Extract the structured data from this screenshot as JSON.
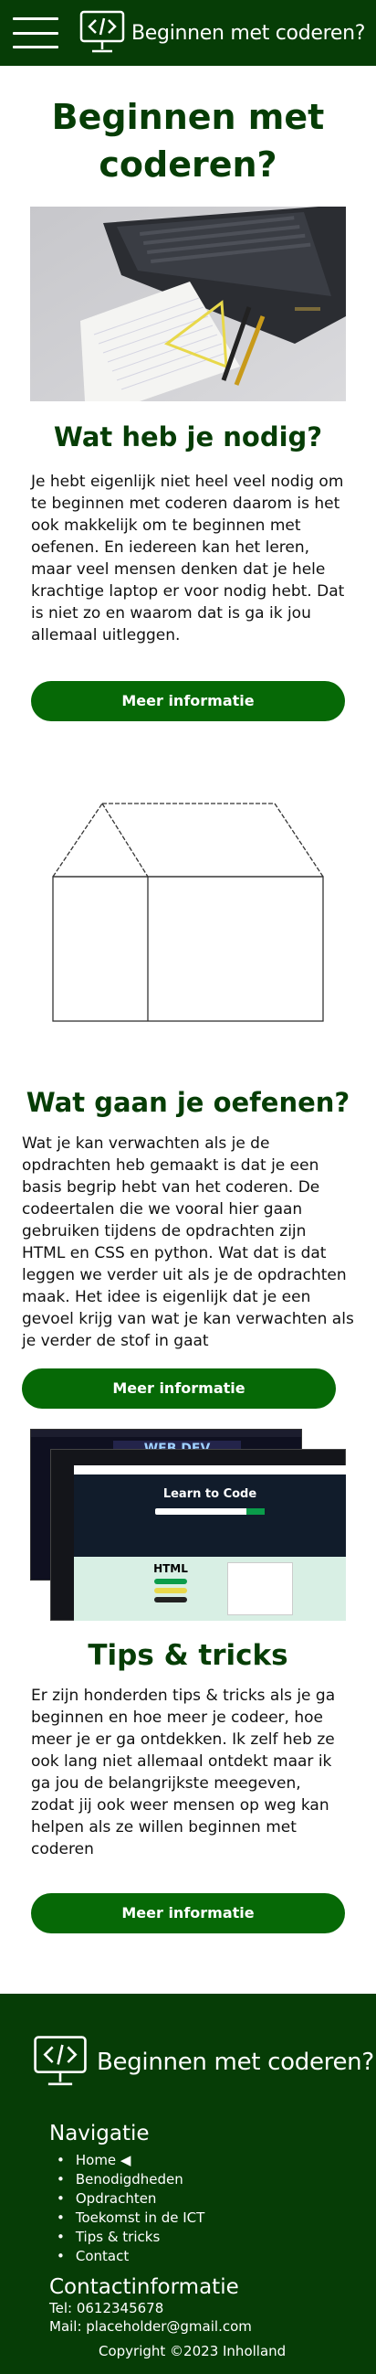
{
  "header": {
    "title": "Beginnen met coderen?",
    "brand_icon": "code-monitor-icon",
    "menu_icon": "hamburger-menu-icon",
    "background": "#063d06"
  },
  "hero": {
    "title": "Beginnen met coderen?",
    "image": "laptop-with-notebook-photo"
  },
  "sections": [
    {
      "title": "Wat heb je nodig?",
      "text": "Je hebt eigenlijk niet heel veel nodig om te beginnen met coderen daarom is het ook makkelijk om te beginnen met oefenen. En iedereen kan het leren, maar veel mensen denken dat je hele krachtige laptop er voor nodig hebt. Dat is niet zo en waarom dat is ga ik jou allemaal uitleggen.",
      "button": "Meer informatie",
      "image": "house-outline-drawing"
    },
    {
      "title": "Wat gaan je oefenen?",
      "text": "Wat je kan verwachten als je de opdrachten heb gemaakt is dat je een basis begrip hebt van het coderen. De codeertalen die we vooral hier gaan gebruiken tijdens de opdrachten zijn HTML en CSS en python. Wat dat is dat leggen we verder uit als je de opdrachten maak. Het idee is eigenlijk dat je een gevoel krijg van wat je kan verwachten als je verder de stof in gaat",
      "button": "Meer informatie",
      "image": "coding-websites-collage"
    },
    {
      "title": "Tips & tricks",
      "text": "Er zijn honderden tips & tricks als je ga beginnen en hoe meer je codeer, hoe meer je er ga ontdekken. Ik zelf heb ze ook lang niet allemaal ontdekt maar ik ga jou de belangrijkste meegeven, zodat jij ook weer mensen op weg kan helpen als ze willen beginnen met coderen",
      "button": "Meer informatie"
    }
  ],
  "collage": {
    "webdev_label": "WEB DEV",
    "learn_title": "Learn to Code",
    "html_label": "HTML"
  },
  "footer": {
    "title": "Beginnen met coderen?",
    "nav_heading": "Navigatie",
    "nav_items": [
      "Home ◀",
      "Benodigdheden",
      "Opdrachten",
      "Toekomst in de ICT",
      "Tips & tricks",
      "Contact"
    ],
    "contact_heading": "Contactinformatie",
    "phone": "Tel: 0612345678",
    "email": "Mail: placeholder@gmail.com",
    "copyright": "Copyright ©2023 Inholland"
  },
  "colors": {
    "dark_green": "#063d06",
    "button_green": "#066906",
    "mint": "#d8efe4"
  }
}
